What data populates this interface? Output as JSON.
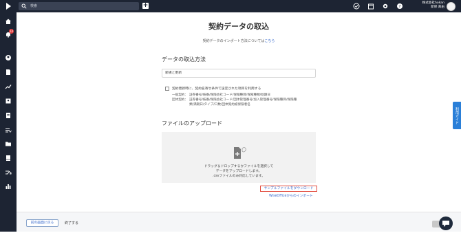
{
  "header": {
    "search_placeholder": "検索",
    "add_label": "+",
    "company": "株式会社hokan",
    "user": "新保 真由"
  },
  "sidebar": {
    "notification_count": "14",
    "items": [
      "home-icon",
      "bell-icon",
      "user-icon",
      "document-icon",
      "chart-icon",
      "id-card-icon",
      "receipt-icon",
      "list-icon",
      "folder-icon",
      "book-icon",
      "shuffle-icon",
      "bar-chart-icon"
    ]
  },
  "page": {
    "title": "契約データの取込",
    "intro_text": "契約データのインポート方法については",
    "intro_link": "こちら"
  },
  "import_method": {
    "title": "データの取込方法",
    "selected": "新規と更新",
    "checkbox_label": "契約更新時に、契約名寄せ条件で設定された項目を利用する",
    "general_label": "一般契約：",
    "general_value": "証券番号/枝番/保険会社コード/保険種目/保険種類/始期日",
    "group_label": "団体契約：",
    "group_value_1": "証券番号/枝番/保険会社コード/団体管理番号/加入管理番号/保険種目/保険種",
    "group_value_2": "類/満期日/タイプ/口数/団体契約被保険者名"
  },
  "upload": {
    "title": "ファイルのアップロード",
    "line1": "ドラッグ＆ドロップするかファイルを選択して",
    "line2": "データをアップロードします。",
    "line3": ".csvファイルのみ対応しています。",
    "sample_link": "サンプルファイルをダウンロード",
    "wise_link": "WiseOfficeからのインポート"
  },
  "side_tab": "利用ガイド",
  "footer": {
    "back_button": "前の画面に戻る",
    "end_text": "終了する"
  },
  "colors": {
    "nav": "#1d2433",
    "accent": "#3366cc",
    "highlight": "#e2483a",
    "badge": "#e23b3b"
  }
}
